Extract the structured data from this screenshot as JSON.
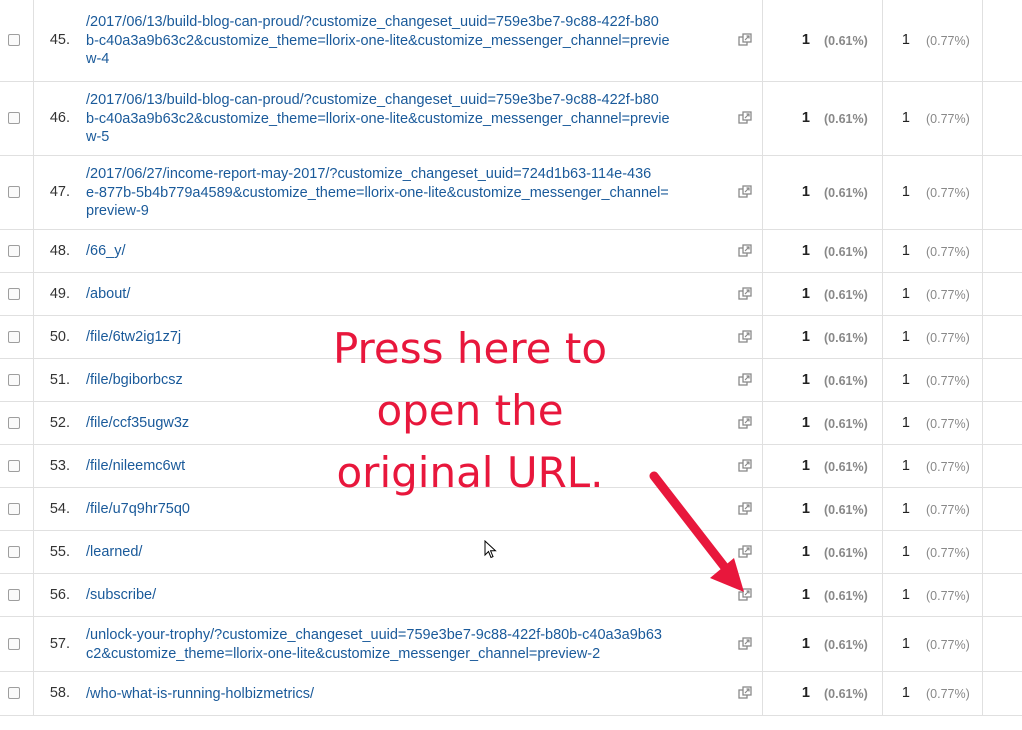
{
  "rows": [
    {
      "num": "45.",
      "url": "/2017/06/13/build-blog-can-proud/?customize_changeset_uuid=759e3be7-9c88-422f-b80\nb-c40a3a9b63c2&customize_theme=llorix-one-lite&customize_messenger_channel=previe\nw-4",
      "m1": "1",
      "m1pct": "(0.61%)",
      "m2": "1",
      "m2pct": "(0.77%)"
    },
    {
      "num": "46.",
      "url": "/2017/06/13/build-blog-can-proud/?customize_changeset_uuid=759e3be7-9c88-422f-b80\nb-c40a3a9b63c2&customize_theme=llorix-one-lite&customize_messenger_channel=previe\nw-5",
      "m1": "1",
      "m1pct": "(0.61%)",
      "m2": "1",
      "m2pct": "(0.77%)"
    },
    {
      "num": "47.",
      "url": "/2017/06/27/income-report-may-2017/?customize_changeset_uuid=724d1b63-114e-436\ne-877b-5b4b779a4589&customize_theme=llorix-one-lite&customize_messenger_channel=\npreview-9",
      "m1": "1",
      "m1pct": "(0.61%)",
      "m2": "1",
      "m2pct": "(0.77%)"
    },
    {
      "num": "48.",
      "url": "/66_y/",
      "m1": "1",
      "m1pct": "(0.61%)",
      "m2": "1",
      "m2pct": "(0.77%)"
    },
    {
      "num": "49.",
      "url": "/about/",
      "m1": "1",
      "m1pct": "(0.61%)",
      "m2": "1",
      "m2pct": "(0.77%)"
    },
    {
      "num": "50.",
      "url": "/file/6tw2ig1z7j",
      "m1": "1",
      "m1pct": "(0.61%)",
      "m2": "1",
      "m2pct": "(0.77%)"
    },
    {
      "num": "51.",
      "url": "/file/bgiborbcsz",
      "m1": "1",
      "m1pct": "(0.61%)",
      "m2": "1",
      "m2pct": "(0.77%)"
    },
    {
      "num": "52.",
      "url": "/file/ccf35ugw3z",
      "m1": "1",
      "m1pct": "(0.61%)",
      "m2": "1",
      "m2pct": "(0.77%)"
    },
    {
      "num": "53.",
      "url": "/file/nileemc6wt",
      "m1": "1",
      "m1pct": "(0.61%)",
      "m2": "1",
      "m2pct": "(0.77%)"
    },
    {
      "num": "54.",
      "url": "/file/u7q9hr75q0",
      "m1": "1",
      "m1pct": "(0.61%)",
      "m2": "1",
      "m2pct": "(0.77%)"
    },
    {
      "num": "55.",
      "url": "/learned/",
      "m1": "1",
      "m1pct": "(0.61%)",
      "m2": "1",
      "m2pct": "(0.77%)"
    },
    {
      "num": "56.",
      "url": "/subscribe/",
      "m1": "1",
      "m1pct": "(0.61%)",
      "m2": "1",
      "m2pct": "(0.77%)"
    },
    {
      "num": "57.",
      "url": "/unlock-your-trophy/?customize_changeset_uuid=759e3be7-9c88-422f-b80b-c40a3a9b63\nc2&customize_theme=llorix-one-lite&customize_messenger_channel=preview-2",
      "m1": "1",
      "m1pct": "(0.61%)",
      "m2": "1",
      "m2pct": "(0.77%)"
    },
    {
      "num": "58.",
      "url": "/who-what-is-running-holbizmetrics/",
      "m1": "1",
      "m1pct": "(0.61%)",
      "m2": "1",
      "m2pct": "(0.77%)"
    }
  ],
  "annotation": {
    "text": "Press here to\nopen the\noriginal URL.",
    "color": "#e8173c"
  },
  "colors": {
    "link": "#1a5a9a",
    "border": "#e0e0e0",
    "arrow": "#e8173c"
  },
  "icons": {
    "row_action": "open-in-new-window-icon",
    "pointer": "mouse-cursor-icon"
  }
}
